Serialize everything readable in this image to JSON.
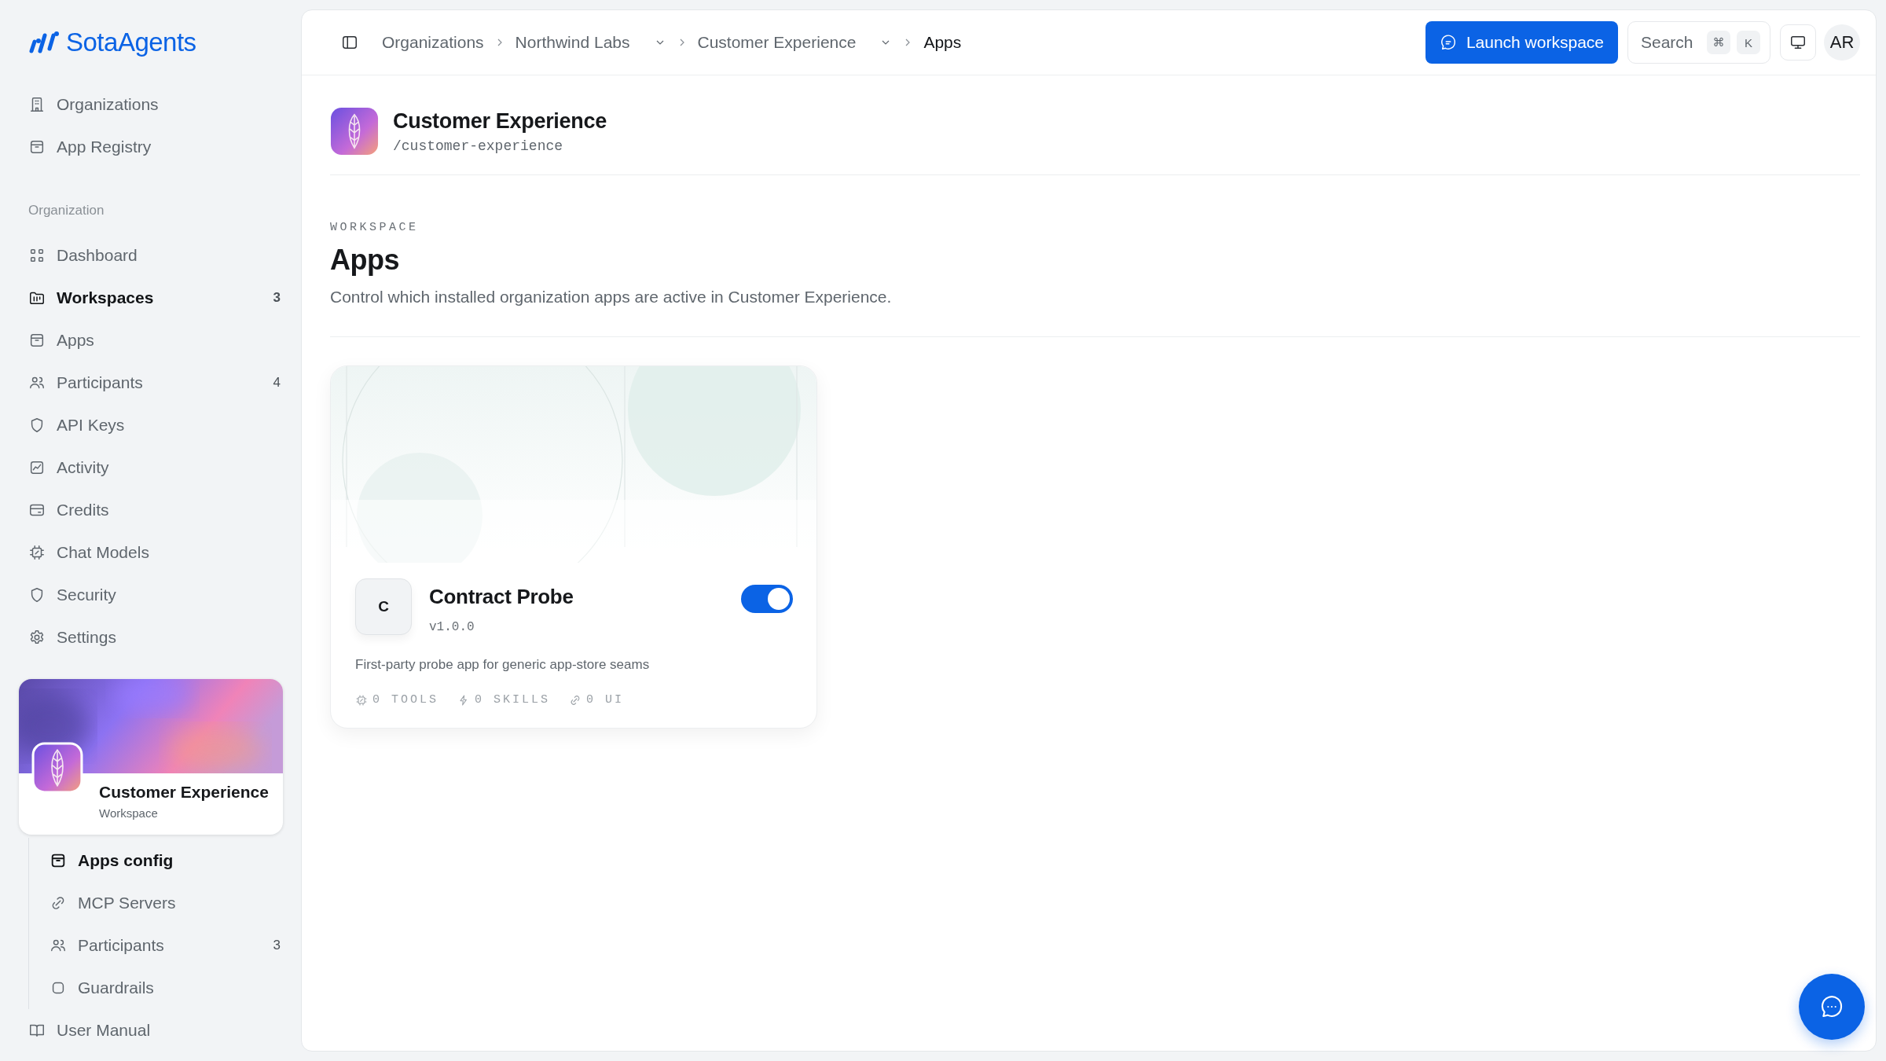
{
  "brand": {
    "name": "SotaAgents"
  },
  "sidebar": {
    "top_items": [
      {
        "label": "Organizations",
        "selected": false
      },
      {
        "label": "App Registry",
        "selected": false
      }
    ],
    "section_label": "Organization",
    "items": [
      {
        "label": "Dashboard",
        "selected": false
      },
      {
        "label": "Workspaces",
        "count": "3",
        "selected": true
      },
      {
        "label": "Apps",
        "selected": false
      },
      {
        "label": "Participants",
        "count": "4",
        "selected": false
      },
      {
        "label": "API Keys",
        "selected": false
      },
      {
        "label": "Activity",
        "selected": false
      },
      {
        "label": "Credits",
        "selected": false
      },
      {
        "label": "Chat Models",
        "selected": false
      },
      {
        "label": "Security",
        "selected": false
      },
      {
        "label": "Settings",
        "selected": false
      }
    ],
    "workspace_card": {
      "name": "Customer Experience",
      "subtitle": "Workspace"
    },
    "sub_items": [
      {
        "label": "Apps config",
        "selected": true
      },
      {
        "label": "MCP Servers",
        "selected": false
      },
      {
        "label": "Participants",
        "count": "3",
        "selected": false
      },
      {
        "label": "Guardrails",
        "selected": false
      }
    ],
    "footer_item": {
      "label": "User Manual"
    }
  },
  "topbar": {
    "breadcrumbs": [
      {
        "label": "Organizations",
        "dropdown": false,
        "selected": false
      },
      {
        "label": "Northwind Labs",
        "dropdown": true,
        "selected": false
      },
      {
        "label": "Customer Experience",
        "dropdown": true,
        "selected": false
      },
      {
        "label": "Apps",
        "dropdown": false,
        "selected": true
      }
    ],
    "launch_button": "Launch workspace",
    "search": {
      "placeholder": "Search",
      "keys": [
        "⌘",
        "K"
      ]
    },
    "avatar": "AR"
  },
  "page": {
    "title": "Customer Experience",
    "slug": "/customer-experience",
    "eyebrow": "WORKSPACE",
    "heading": "Apps",
    "description": "Control which installed organization apps are active in Customer Experience."
  },
  "apps": [
    {
      "initial": "C",
      "name": "Contract Probe",
      "version": "v1.0.0",
      "description": "First-party probe app for generic app-store seams",
      "on": true,
      "stats": [
        {
          "kind": "tools",
          "label": "0 TOOLS"
        },
        {
          "kind": "skills",
          "label": "0 SKILLS"
        },
        {
          "kind": "ui",
          "label": "0 UI"
        }
      ]
    }
  ]
}
